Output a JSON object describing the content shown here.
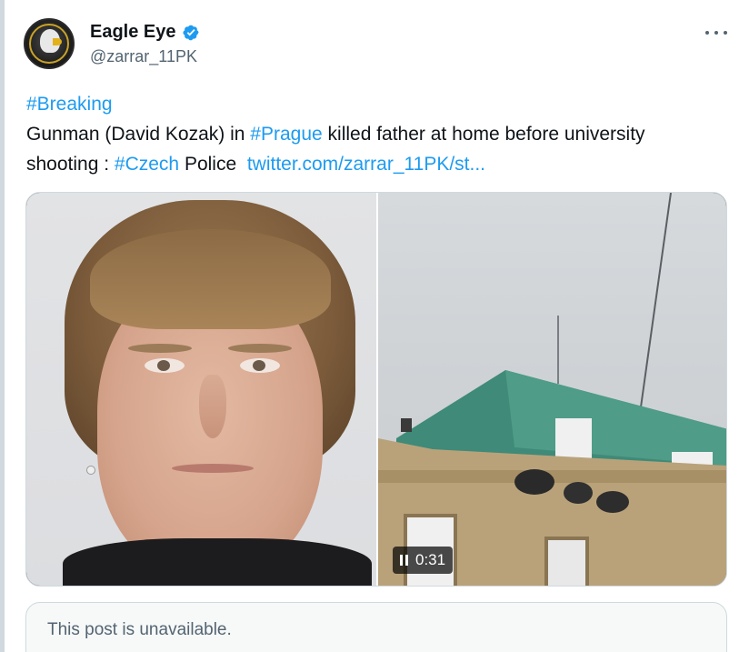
{
  "author": {
    "display_name": "Eagle Eye",
    "handle": "@zarrar_11PK",
    "verified_icon": "verified-badge-icon",
    "avatar_icon": "eagle-avatar"
  },
  "tweet": {
    "line1_hashtag": "#Breaking",
    "line2_prefix": "Gunman (David Kozak) in ",
    "line2_hashtag": "#Prague",
    "line2_suffix": " killed father at home before university",
    "line3_prefix": "shooting : ",
    "line3_hashtag": "#Czech",
    "line3_middle": " Police  ",
    "line3_link": "twitter.com/zarrar_11PK/st..."
  },
  "media": {
    "video_time": "0:31",
    "pause_icon": "pause-icon"
  },
  "quote": {
    "text": "This post is unavailable."
  },
  "colors": {
    "link": "#1d9bf0",
    "text": "#0f1419",
    "secondary": "#536471",
    "verified": "#1d9bf0",
    "border": "#cfd9de"
  }
}
